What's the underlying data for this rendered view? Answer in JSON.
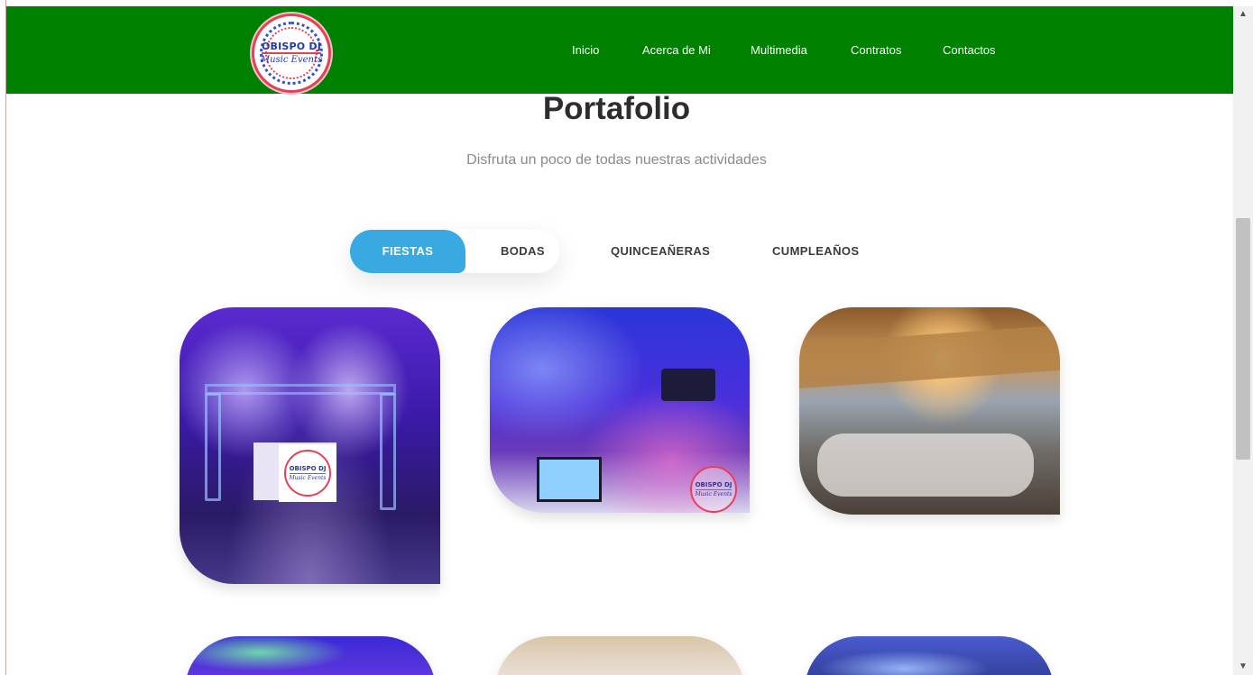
{
  "brand": {
    "logo_line1": "OBISPO DJ",
    "logo_line2": "Music Events",
    "nav_color": "#008000"
  },
  "nav": {
    "items": [
      {
        "label": "Inicio"
      },
      {
        "label": "Acerca de Mi"
      },
      {
        "label": "Multimedia"
      },
      {
        "label": "Contratos"
      },
      {
        "label": "Contactos"
      }
    ]
  },
  "portfolio": {
    "title": "Portafolio",
    "subtitle": "Disfruta un poco de todas nuestras actividades",
    "accent": "#38a9e1",
    "filters": [
      {
        "label": "FIESTAS",
        "active": true
      },
      {
        "label": "BODAS",
        "active": false
      },
      {
        "label": "QUINCEAÑERAS",
        "active": false
      },
      {
        "label": "CUMPLEAÑOS",
        "active": false
      }
    ],
    "gallery": [
      {
        "name": "dj-booth-purple-lights"
      },
      {
        "name": "blue-lit-banquet-hall"
      },
      {
        "name": "sunset-terrace-event"
      },
      {
        "name": "green-laser-show"
      },
      {
        "name": "decorated-venue"
      },
      {
        "name": "blue-stage-lights"
      }
    ]
  },
  "scrollbar": {
    "up_icon": "chevron-up-icon",
    "down_icon": "chevron-down-icon"
  }
}
